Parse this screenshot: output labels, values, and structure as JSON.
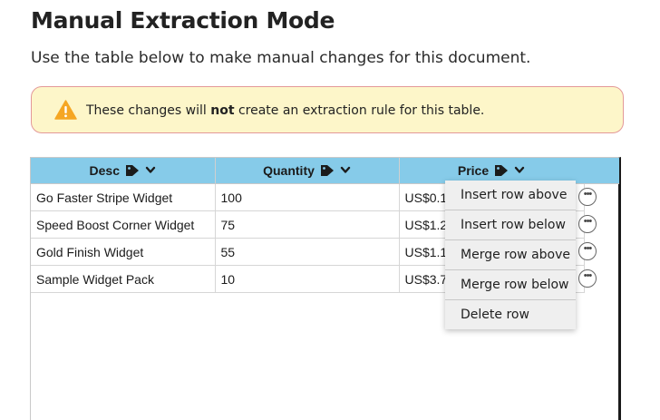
{
  "page": {
    "title": "Manual Extraction Mode",
    "subtitle": "Use the table below to make manual changes for this document."
  },
  "warning": {
    "text_before": "These changes will ",
    "text_bold": "not",
    "text_after": " create an extraction rule for this table.",
    "icon": "warning-triangle-icon",
    "icon_color": "#f5a623"
  },
  "table": {
    "header_color": "#86cbe9",
    "columns": [
      {
        "label": "Desc"
      },
      {
        "label": "Quantity"
      },
      {
        "label": "Price"
      }
    ],
    "rows": [
      {
        "desc": "Go Faster Stripe Widget",
        "quantity": "100",
        "price": "US$0.1"
      },
      {
        "desc": "Speed Boost Corner Widget",
        "quantity": "75",
        "price": "US$1.2"
      },
      {
        "desc": "Gold Finish Widget",
        "quantity": "55",
        "price": "US$1.1"
      },
      {
        "desc": "Sample Widget Pack",
        "quantity": "10",
        "price": "US$3.7"
      }
    ],
    "row_menu_icon": "ellipsis-circle-icon"
  },
  "context_menu": {
    "items": [
      {
        "label": "Insert row above"
      },
      {
        "label": "Insert row below"
      },
      {
        "label": "Merge row above"
      },
      {
        "label": "Merge row below"
      },
      {
        "label": "Delete row"
      }
    ]
  }
}
